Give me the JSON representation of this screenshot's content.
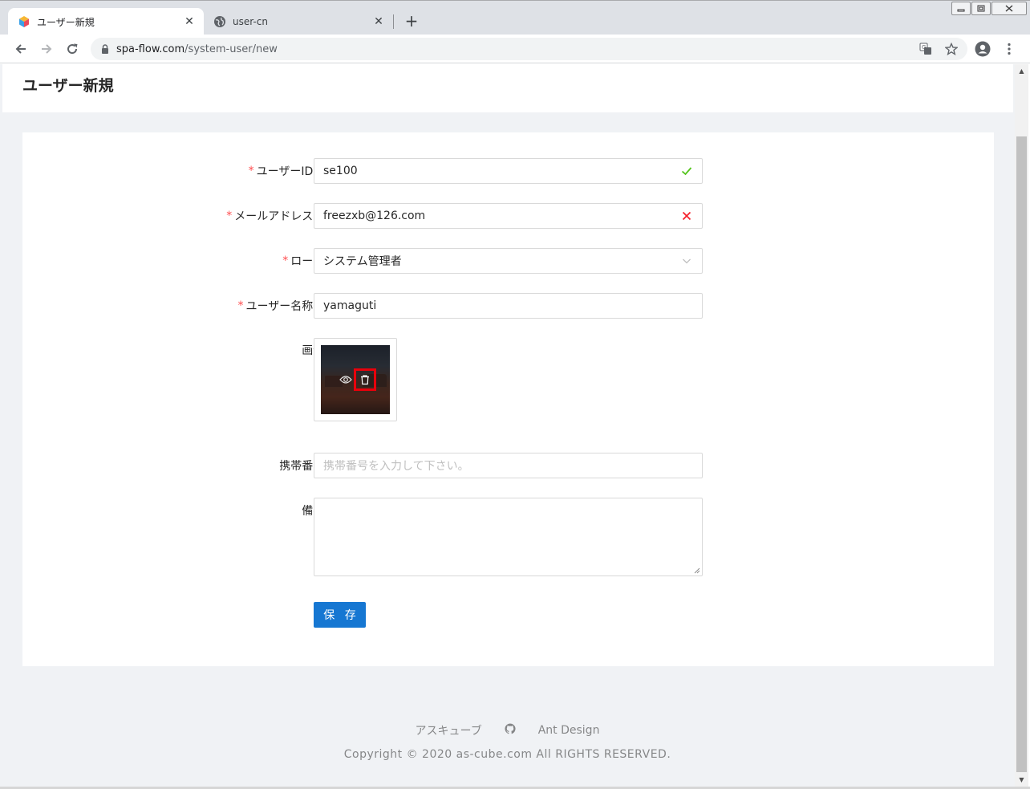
{
  "browser": {
    "tabs": [
      {
        "title": "ユーザー新規",
        "active": true
      },
      {
        "title": "user-cn",
        "active": false
      }
    ],
    "address": {
      "host": "spa-flow.com",
      "path": "/system-user/new"
    }
  },
  "page": {
    "title": "ユーザー新規"
  },
  "form": {
    "user_id": {
      "label": "ユーザーID",
      "value": "se100",
      "status": "success"
    },
    "email": {
      "label": "メールアドレス",
      "value": "freezxb@126.com",
      "status": "error"
    },
    "role": {
      "label": "ロール",
      "value": "システム管理者"
    },
    "user_name": {
      "label": "ユーザー名称",
      "value": "yamaguti"
    },
    "image": {
      "label": "画像"
    },
    "phone": {
      "label": "携帯番号",
      "placeholder": "携帯番号を入力して下さい。",
      "value": ""
    },
    "remarks": {
      "label": "備考",
      "value": ""
    },
    "save_label": "保 存"
  },
  "footer": {
    "links": [
      "アスキューブ",
      "Ant Design"
    ],
    "copyright": "Copyright © 2020 as-cube.com All RIGHTS RESERVED."
  },
  "colors": {
    "primary": "#1677d2",
    "success": "#52c41a",
    "error": "#f5222d",
    "required": "#ff4d4f",
    "highlight": "#e8000b"
  }
}
